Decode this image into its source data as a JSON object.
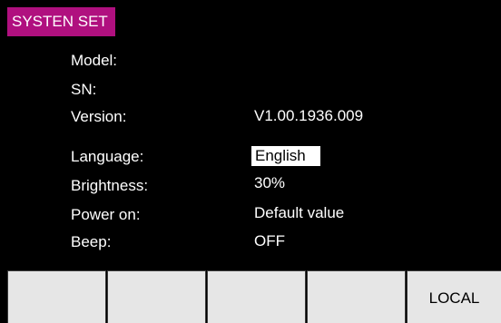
{
  "window": {
    "title": "SYSTEN SET"
  },
  "info": {
    "model_label": "Model:",
    "model_value": "",
    "sn_label": "SN:",
    "sn_value": "",
    "version_label": "Version:",
    "version_value": "V1.00.1936.009"
  },
  "settings": {
    "language_label": "Language:",
    "language_value": "English",
    "brightness_label": "Brightness:",
    "brightness_value": "30%",
    "power_on_label": "Power on:",
    "power_on_value": "Default value",
    "beep_label": "Beep:",
    "beep_value": "OFF"
  },
  "softkeys": [
    "",
    "",
    "",
    "",
    "LOCAL"
  ],
  "colors": {
    "title_bg": "#b0107f",
    "screen_bg": "#000000",
    "softkey_bg": "#e6e6e6",
    "selection_bg": "#ffffff"
  }
}
